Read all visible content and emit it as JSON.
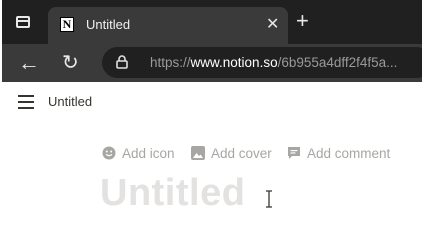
{
  "browser": {
    "tab": {
      "favicon": "notion-icon",
      "title": "Untitled",
      "close_glyph": "✕"
    },
    "new_tab_glyph": "+",
    "address": {
      "scheme": "https://",
      "host": "www.notion.so",
      "path": "/6b955a4dff2f4f5a..."
    },
    "theme": {
      "chrome_dark": "#202020",
      "chrome_mid": "#3a3a3a"
    }
  },
  "page": {
    "breadcrumb": "Untitled",
    "actions": {
      "add_icon": "Add icon",
      "add_cover": "Add cover",
      "add_comment": "Add comment"
    },
    "title_placeholder": "Untitled",
    "colors": {
      "text": "#37352f",
      "muted": "#a7a6a2",
      "placeholder": "#e3e2e0"
    }
  }
}
